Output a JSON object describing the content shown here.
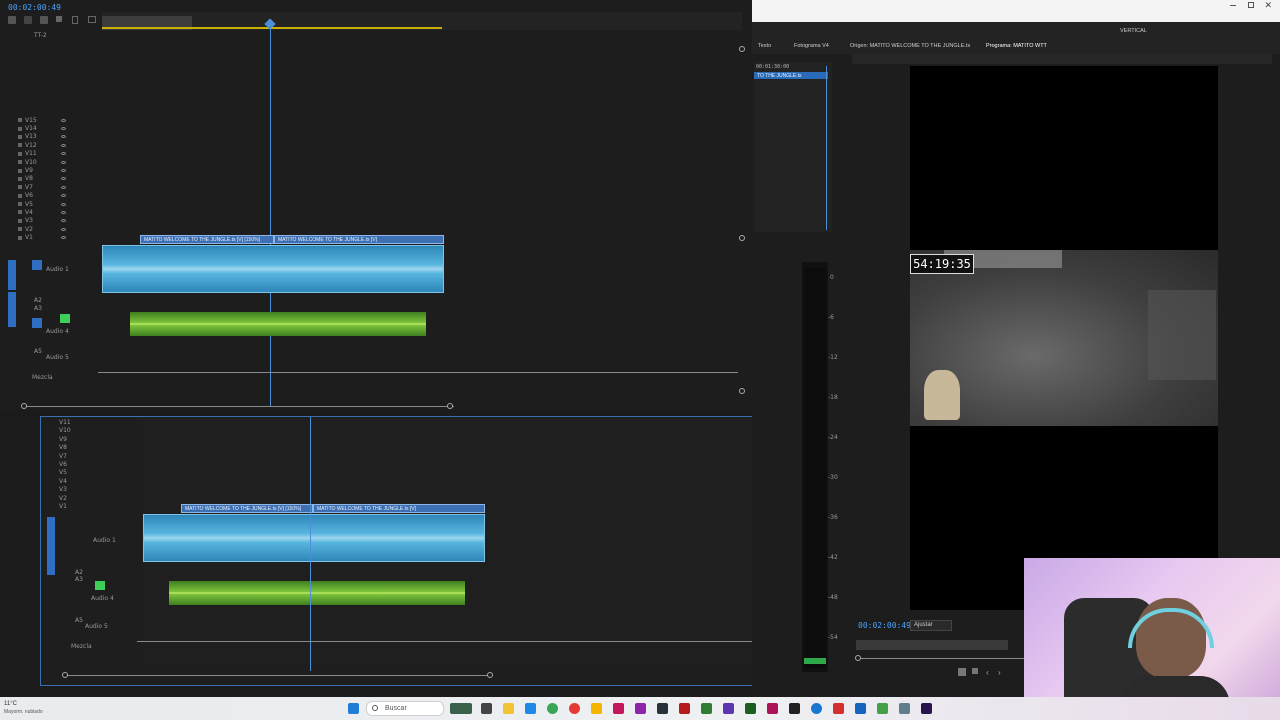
{
  "top_panel": {
    "timecode": "00:02:00:49",
    "sequence_label": "TT-2",
    "video_tracks": [
      "V15",
      "V14",
      "V13",
      "V12",
      "V11",
      "V10",
      "V9",
      "V8",
      "V7",
      "V6",
      "V5",
      "V4",
      "V3",
      "V2",
      "V1"
    ],
    "audio_tracks": [
      {
        "id": "A1",
        "name": "Audio 1"
      },
      {
        "id": "A2",
        "name": ""
      },
      {
        "id": "A3",
        "name": ""
      },
      {
        "id": "A4",
        "name": "Audio 4"
      },
      {
        "id": "A5",
        "name": "Audio 5"
      }
    ],
    "mix_label": "Mezcla",
    "clip1_title": "MATITO WELCOME TO THE JUNGLE.ts [V] [150%]",
    "clip2_title": "MATITO WELCOME TO THE JUNGLE.ts [V]"
  },
  "bottom_panel": {
    "video_tracks": [
      "V11",
      "V10",
      "V9",
      "V8",
      "V7",
      "V6",
      "V5",
      "V4",
      "V3",
      "V2",
      "V1"
    ],
    "audio_tracks": [
      {
        "id": "A1",
        "name": "Audio 1"
      },
      {
        "id": "A2",
        "name": ""
      },
      {
        "id": "A3",
        "name": ""
      },
      {
        "id": "A4",
        "name": "Audio 4"
      },
      {
        "id": "A5",
        "name": "Audio 5"
      }
    ],
    "mix_label": "Mezcla",
    "clip1_title": "MATITO WELCOME TO THE JUNGLE.ts [V] [150%]",
    "clip2_title": "MATITO WELCOME TO THE JUNGLE.ts [V]"
  },
  "right_panel": {
    "workspace_label": "VERTICAL",
    "tabs_left": [
      "Texto",
      "Fotograma V4"
    ],
    "tab_source": "Origen: MATITO WELCOME TO THE JUNGLE.ts",
    "tab_program": "Programa: MATITO WTT",
    "mini_timecode": "00:01:30:00",
    "mini_clip": "TO THE JUNGLE.ts",
    "overlay_timer": "54:19:35",
    "program_timecode": "00:02:00:49",
    "fit_label": "Ajustar",
    "meter_scale": [
      "0",
      "-6",
      "-12",
      "-18",
      "-24",
      "-30",
      "-36",
      "-42",
      "-48",
      "-54"
    ]
  },
  "taskbar": {
    "weather": "11°C",
    "weather_desc": "Mayorm. nublado",
    "search_placeholder": "Buscar"
  },
  "colors": {
    "timecode_blue": "#4ba3ff",
    "audio_clip_blue": "#56b5de",
    "music_clip_green": "#7ec43c"
  }
}
